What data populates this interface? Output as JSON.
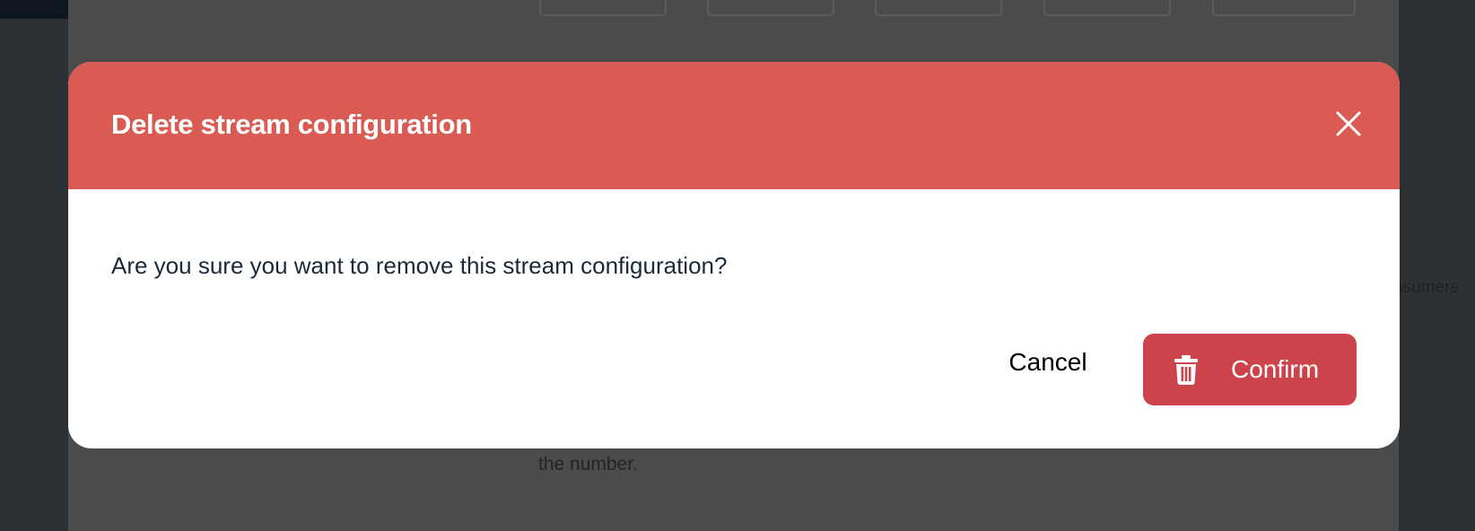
{
  "background": {
    "right_text": "nsumers",
    "bottom_text": "the number."
  },
  "modal": {
    "title": "Delete stream configuration",
    "message": "Are you sure you want to remove this stream configuration?",
    "close_icon": "close-icon",
    "cancel_label": "Cancel",
    "confirm_label": "Confirm",
    "confirm_icon": "trash-icon"
  },
  "colors": {
    "header": "#d95b53",
    "confirm": "#cd434b",
    "backdrop": "#4b4b4b"
  }
}
